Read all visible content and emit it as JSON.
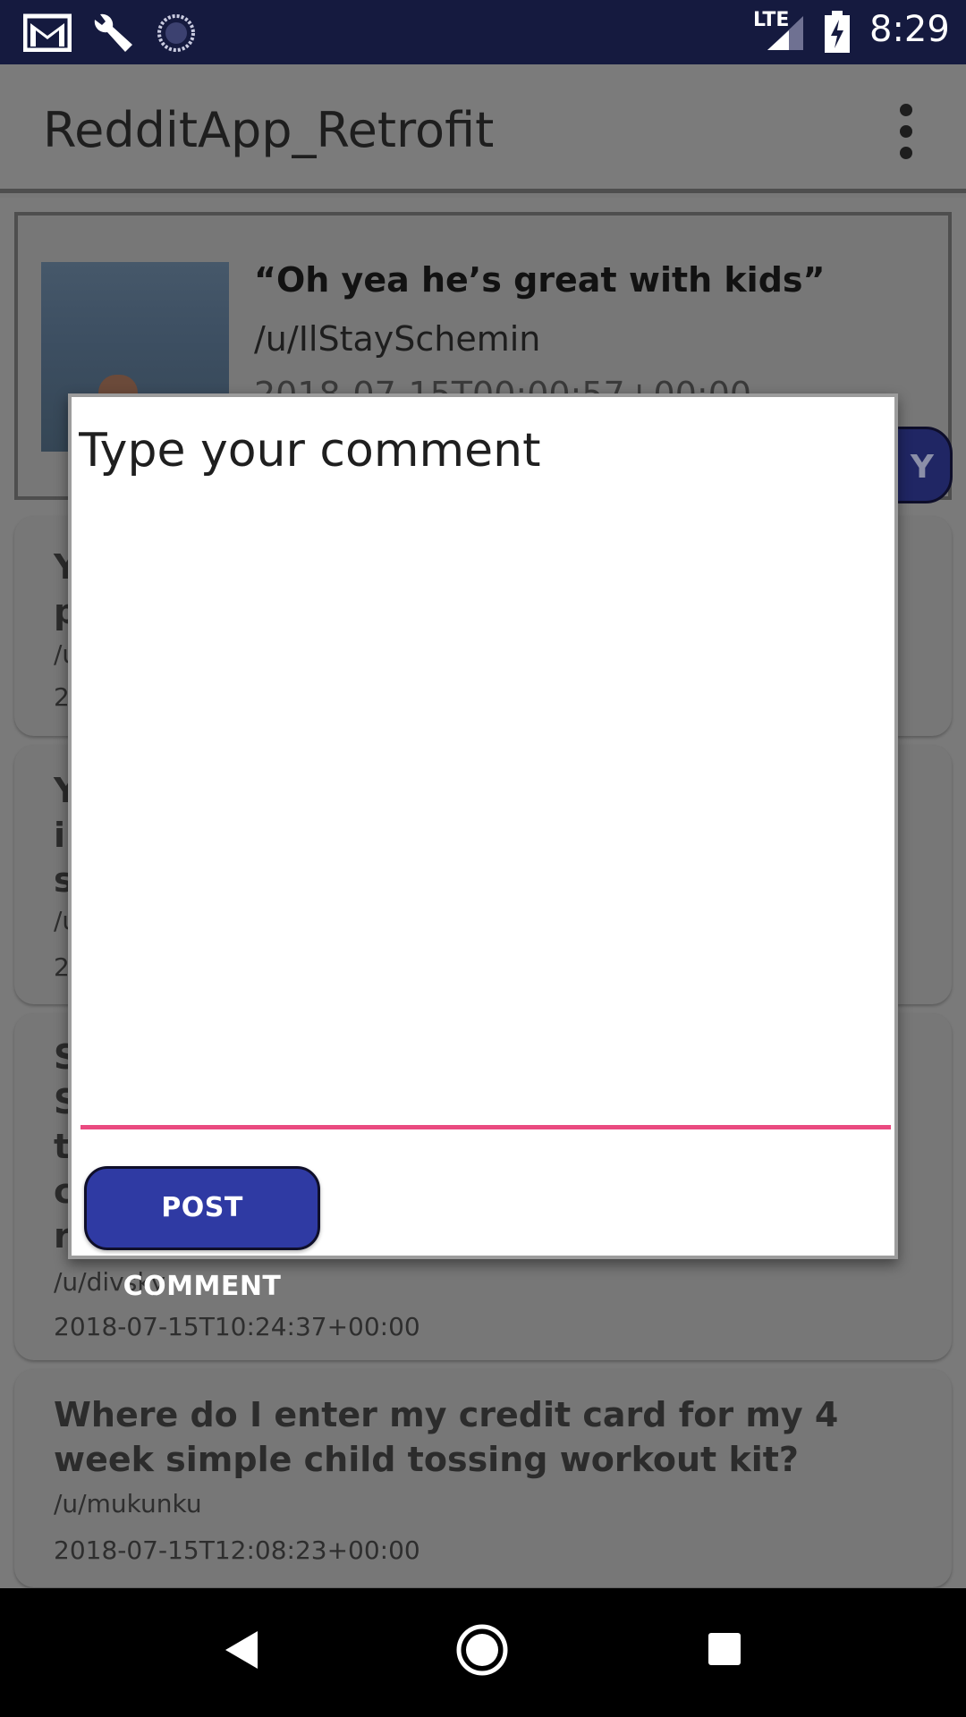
{
  "status_bar": {
    "time": "8:29",
    "network_label": "LTE",
    "icons": [
      "gmail-icon",
      "wrench-icon",
      "sync-icon",
      "signal-icon",
      "battery-charging-icon"
    ]
  },
  "app_bar": {
    "title": "RedditApp_Retrofit",
    "menu_icon": "overflow-menu-icon"
  },
  "feature_post": {
    "title": "“Oh yea he’s great with kids”",
    "author": "/u/IlStaySchemin",
    "date": "2018-07-15T00:00:57+00:00",
    "reply_label": "Y"
  },
  "posts": [
    {
      "title": "Y\np",
      "author": "/u",
      "date": "2"
    },
    {
      "title": "Y\ni\ns",
      "author": "/u",
      "date": "2"
    },
    {
      "title": "S\nS\nt\nc\nr",
      "author": "/u/divsky",
      "date": "2018-07-15T10:24:37+00:00"
    },
    {
      "title": "Where do I enter my credit card for my 4 week simple child tossing workout kit?",
      "author": "/u/mukunku",
      "date": "2018-07-15T12:08:23+00:00"
    }
  ],
  "dialog": {
    "placeholder": "Type your comment",
    "value": "",
    "button_label": "POST COMMENT"
  },
  "colors": {
    "status_bar": "#151a3f",
    "accent_underline": "#ea4a80",
    "button": "#2f3aa3",
    "scrim": "#777777"
  }
}
